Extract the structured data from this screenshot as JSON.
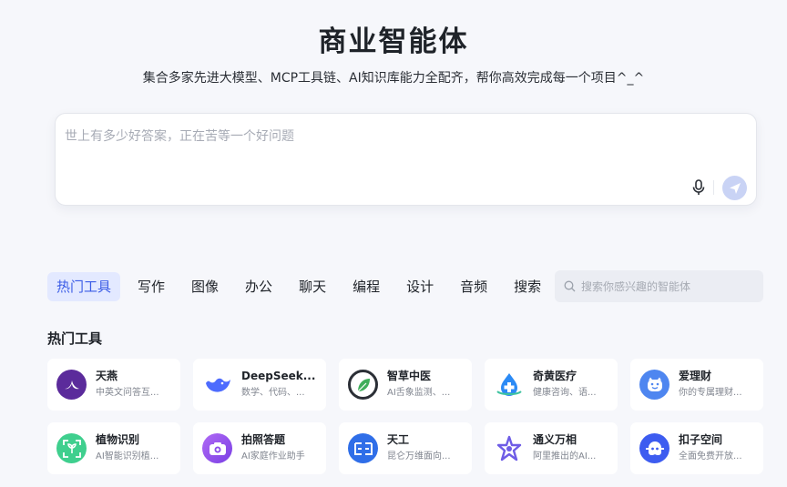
{
  "header": {
    "title": "商业智能体",
    "subtitle": "集合多家先进大模型、MCP工具链、AI知识库能力全配齐，帮你高效完成每一个项目^_^"
  },
  "chat": {
    "placeholder": "世上有多少好答案，正在苦等一个好问题"
  },
  "tabs": [
    "热门工具",
    "写作",
    "图像",
    "办公",
    "聊天",
    "编程",
    "设计",
    "音频",
    "搜索"
  ],
  "search": {
    "placeholder": "搜索你感兴趣的智能体"
  },
  "section_title": "热门工具",
  "tools": [
    {
      "name": "天燕",
      "desc": "中英文问答互...",
      "color": "#5b2b9b",
      "icon": "swallow-icon"
    },
    {
      "name": "DeepSeek...",
      "desc": "数学、代码、...",
      "color": "#4d6bfe",
      "icon": "whale-icon"
    },
    {
      "name": "智草中医",
      "desc": "AI舌象监测、...",
      "color": "#2b2f36",
      "icon": "leaf-icon"
    },
    {
      "name": "奇黄医疗",
      "desc": "健康咨询、语...",
      "color": "#2b8af5",
      "icon": "medical-drop-icon"
    },
    {
      "name": "爱理财",
      "desc": "你的专属理财...",
      "color": "#4e86f0",
      "icon": "piggy-icon"
    },
    {
      "name": "植物识别",
      "desc": "AI智能识别植...",
      "color": "#3fcf8e",
      "icon": "plant-scan-icon"
    },
    {
      "name": "拍照答题",
      "desc": "AI家庭作业助手",
      "color": "#8b4dea",
      "icon": "camera-icon"
    },
    {
      "name": "天工",
      "desc": "昆仑万维面向...",
      "color": "#2f6ee8",
      "icon": "tiangong-icon"
    },
    {
      "name": "通义万相",
      "desc": "阿里推出的AI...",
      "color": "#6e5ce6",
      "icon": "star-hexagon-icon"
    },
    {
      "name": "扣子空间",
      "desc": "全面免费开放...",
      "color": "#3d5cf0",
      "icon": "coze-icon"
    }
  ]
}
